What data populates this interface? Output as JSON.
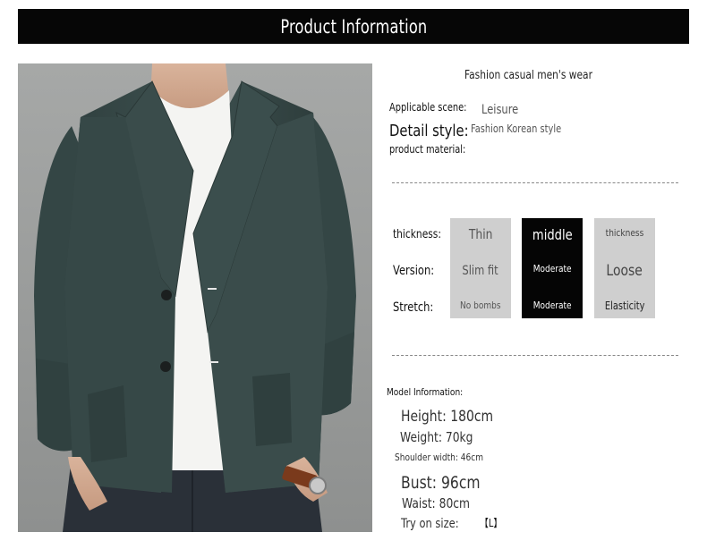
{
  "header": {
    "title": "Product Information"
  },
  "product": {
    "subtitle": "Fashion casual men's wear",
    "applicable_scene_label": "Applicable scene:",
    "applicable_scene_value": "Leisure",
    "detail_style_label": "Detail style:",
    "detail_style_value": "Fashion Korean style",
    "material_label": "product material:"
  },
  "attributes": {
    "rows": {
      "thickness": "thickness:",
      "version": "Version:",
      "stretch": "Stretch:"
    },
    "columns": [
      {
        "thickness": "Thin",
        "version": "Slim fit",
        "stretch": "No bombs",
        "highlighted": false
      },
      {
        "thickness": "middle",
        "version": "Moderate",
        "stretch": "Moderate",
        "highlighted": true
      },
      {
        "thickness": "thickness",
        "version": "Loose",
        "stretch": "Elasticity",
        "highlighted": false
      }
    ],
    "highlight_color": "#050505",
    "default_color": "#cfcfcf"
  },
  "model": {
    "heading": "Model Information:",
    "height": "Height: 180cm",
    "weight": "Weight: 70kg",
    "shoulder": "Shoulder width: 46cm",
    "bust": "Bust: 96cm",
    "waist": "Waist: 80cm",
    "try_on_label": "Try on size:",
    "try_on_value": "【L】"
  },
  "image": {
    "description_icon": "model-wearing-green-knit-blazer",
    "blazer_color": "#3b4d4c"
  }
}
